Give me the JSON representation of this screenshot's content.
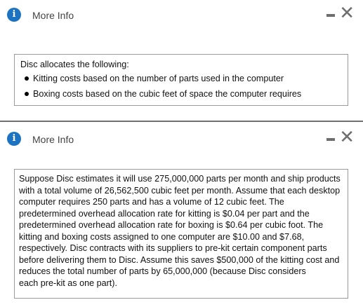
{
  "panel1": {
    "title": "More Info",
    "info_icon": "i",
    "minimize_icon": "minimize-icon",
    "close_icon": "✕",
    "intro": "Disc allocates the following:",
    "bullets": [
      "Kitting costs based on the number of parts used in the computer",
      "Boxing costs based on the cubic feet of space the computer requires"
    ]
  },
  "panel2": {
    "title": "More Info",
    "info_icon": "i",
    "close_icon": "✕",
    "lines": [
      "Suppose Disc estimates it will use 275,000,000 parts per month and ship products",
      "with a total volume of 26,562,500 cubic feet per month. Assume that each desktop",
      "computer requires 250 parts and has a volume of 12 cubic feet. The",
      "predetermined overhead allocation rate for kitting is $0.04 per part and the",
      "predetermined overhead allocation rate for boxing is $0.64 per cubic foot. The",
      "kitting and boxing costs assigned to one computer are $10.00 and $7.68,",
      "respectively. Disc contracts with its suppliers to pre-kit certain component parts",
      "before delivering them to Disc. Assume this saves $500,000 of the kitting cost and",
      "reduces the total number of parts by 65,000,000 (because Disc considers",
      "each pre-kit as one part)."
    ]
  },
  "colors": {
    "info_icon_bg": "#1c73c2",
    "window_controls": "#6e6e6e",
    "border": "#9a9a9a"
  }
}
